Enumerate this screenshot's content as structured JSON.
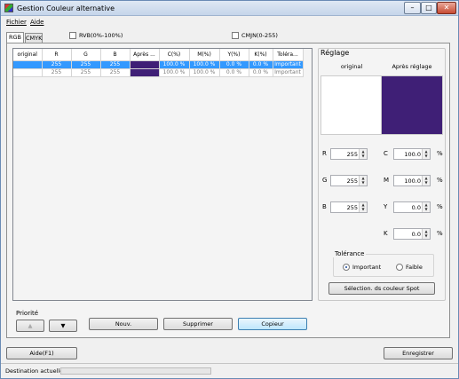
{
  "window": {
    "title": "Gestion Couleur alternative"
  },
  "title_buttons": {
    "minimize": "–",
    "maximize": "□",
    "close": "✕"
  },
  "menu": {
    "fichier": "Fichier",
    "aide": "Aide"
  },
  "tabs": {
    "rgb": "RGB",
    "cmyk": "CMYK"
  },
  "options": {
    "rvb_pct": "RVB(0%-100%)",
    "cmjn": "CMJN(0-255)",
    "rvb_checked": false,
    "cmjn_checked": false
  },
  "table": {
    "headers": [
      "original",
      "R",
      "G",
      "B",
      "Après ...",
      "C(%)",
      "M(%)",
      "Y(%)",
      "K(%)",
      "Toléra..."
    ],
    "rows": [
      {
        "original": "",
        "r": "255",
        "g": "255",
        "b": "255",
        "c": "100.0 %",
        "m": "100.0 %",
        "y": "0.0 %",
        "k": "0.0 %",
        "tol": "Important",
        "selected": true
      },
      {
        "original": "",
        "r": "255",
        "g": "255",
        "b": "255",
        "c": "100.0 %",
        "m": "100.0 %",
        "y": "0.0 %",
        "k": "0.0 %",
        "tol": "Important",
        "selected": false
      }
    ]
  },
  "reglage": {
    "title": "Réglage",
    "original_label": "original",
    "after_label": "Après réglage",
    "original_color": "#ffffff",
    "after_color": "#3f1f76",
    "r_label": "R",
    "r_value": "255",
    "g_label": "G",
    "g_value": "255",
    "b_label": "B",
    "b_value": "255",
    "c_label": "C",
    "c_value": "100.0",
    "m_label": "M",
    "m_value": "100.0",
    "y_label": "Y",
    "y_value": "0.0",
    "k_label": "K",
    "k_value": "0.0",
    "pct": "%",
    "tolerance_title": "Tolérance",
    "important": "Important",
    "faible": "Faible",
    "tolerance_selected": "Important",
    "spot_button": "Sélection. ds couleur Spot"
  },
  "priorite": {
    "label": "Priorité",
    "up": "▲",
    "down": "▼"
  },
  "actions": {
    "nouv": "Nouv.",
    "supprimer": "Supprimer",
    "copieur": "Copieur"
  },
  "footer": {
    "aide": "Aide(F1)",
    "enregistrer": "Enregistrer"
  },
  "status": {
    "text": "Destination actuelle",
    "progress": 0.0
  }
}
